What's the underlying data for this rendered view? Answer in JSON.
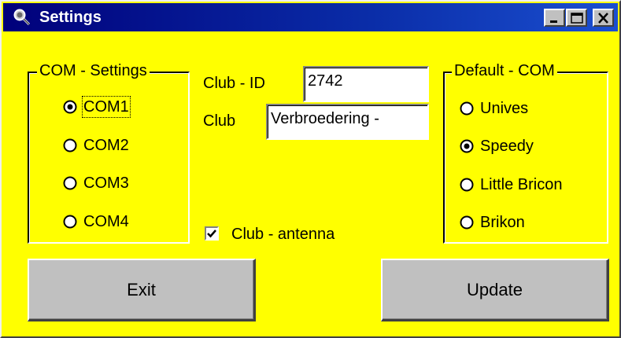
{
  "window": {
    "title": "Settings",
    "icon": "magnifier-app-icon",
    "colors": {
      "background": "#ffff00",
      "titlebar": "#00007b",
      "button_face": "#c0c0c0"
    }
  },
  "com_settings": {
    "title": "COM - Settings",
    "options": [
      {
        "label": "COM1",
        "selected": true
      },
      {
        "label": "COM2",
        "selected": false
      },
      {
        "label": "COM3",
        "selected": false
      },
      {
        "label": "COM4",
        "selected": false
      }
    ]
  },
  "club": {
    "id_label": "Club - ID",
    "id_value": "2742",
    "name_label": "Club",
    "name_value": "Verbroedering -",
    "antenna_label": "Club - antenna",
    "antenna_checked": true
  },
  "default_com": {
    "title": "Default - COM",
    "options": [
      {
        "label": "Unives",
        "selected": false
      },
      {
        "label": "Speedy",
        "selected": true
      },
      {
        "label": "Little Bricon",
        "selected": false
      },
      {
        "label": "Brikon",
        "selected": false
      }
    ]
  },
  "buttons": {
    "exit_label": "Exit",
    "update_label": "Update"
  }
}
